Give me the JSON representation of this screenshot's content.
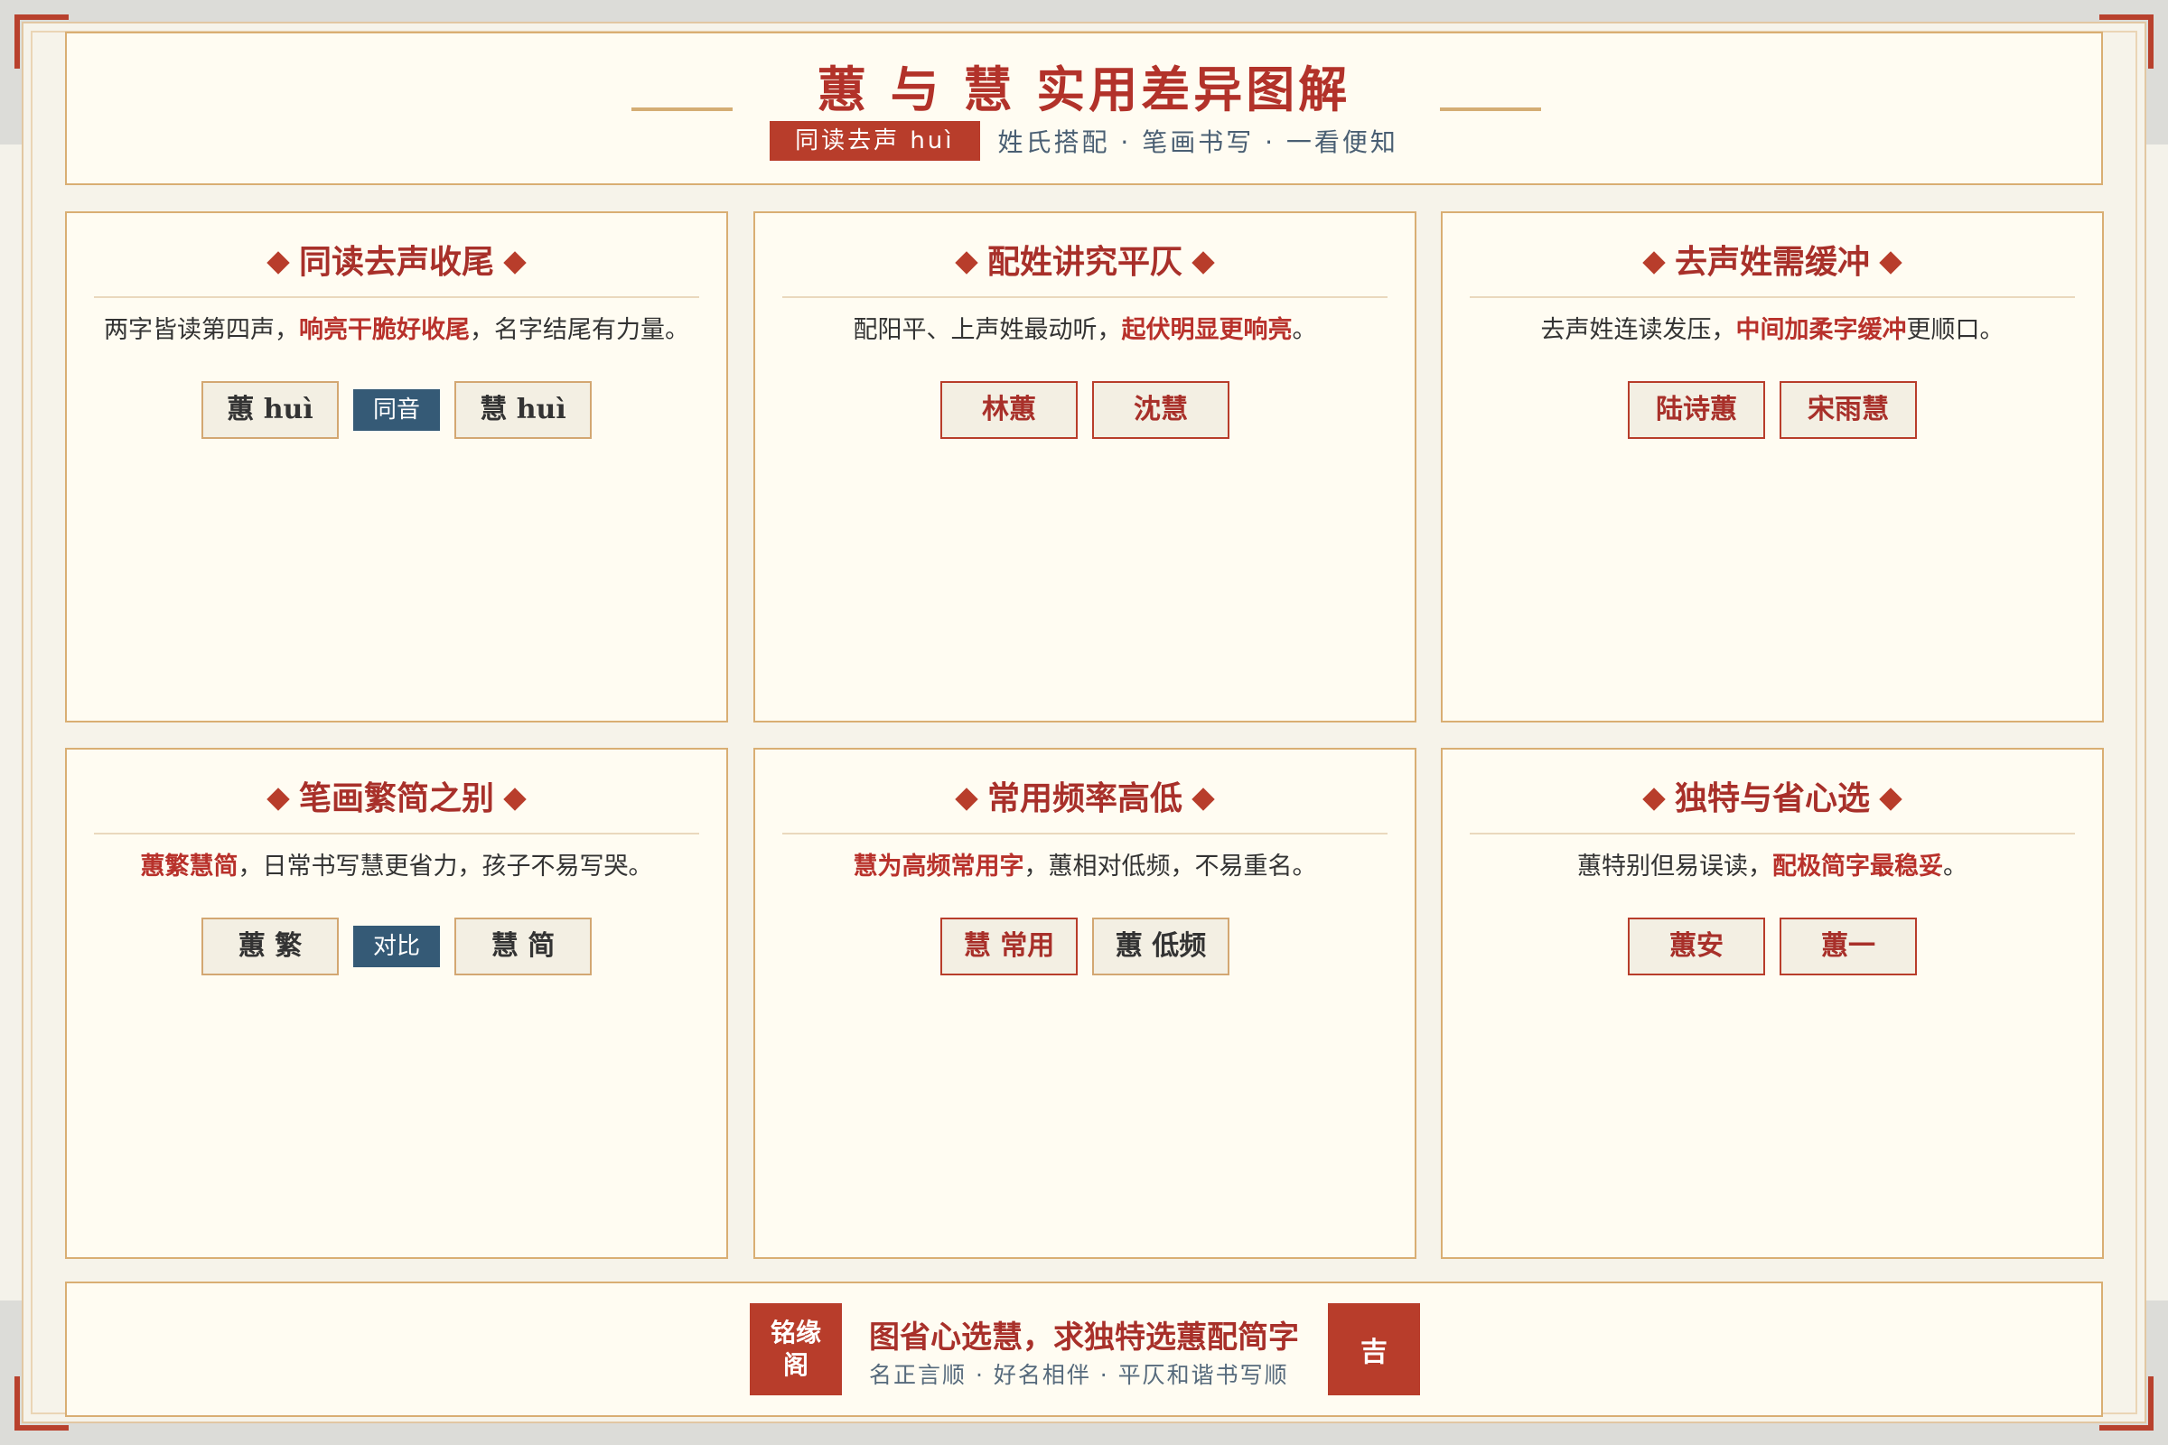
{
  "header": {
    "title": "蕙 与 慧 实用差异图解",
    "pill": "同读去声 huì",
    "subtitle": "姓氏搭配 · 笔画书写 · 一看便知"
  },
  "cards": [
    {
      "title": "同读去声收尾",
      "desc": [
        "两字皆读第四声，",
        "响亮干脆好收尾",
        "，名字结尾有力量。"
      ],
      "tags": [
        "蕙 huì",
        "慧 huì"
      ],
      "mid": "同音"
    },
    {
      "title": "配姓讲究平仄",
      "desc": [
        "配阳平、上声姓最动听，",
        "起伏明显更响亮",
        "。"
      ],
      "tags": [
        "林蕙",
        "沈慧"
      ]
    },
    {
      "title": "去声姓需缓冲",
      "desc": [
        "去声姓连读发压，",
        "中间加柔字缓冲",
        "更顺口。"
      ],
      "tags": [
        "陆诗蕙",
        "宋雨慧"
      ]
    },
    {
      "title": "笔画繁简之别",
      "desc": [
        "",
        "蕙繁慧简",
        "，日常书写慧更省力，孩子不易写哭。"
      ],
      "tags": [
        "蕙 繁",
        "慧 简"
      ],
      "mid": "对比"
    },
    {
      "title": "常用频率高低",
      "desc": [
        "",
        "慧为高频常用字",
        "，蕙相对低频，不易重名。"
      ],
      "tags": [
        "慧 常用",
        "蕙 低频"
      ]
    },
    {
      "title": "独特与省心选",
      "desc": [
        "蕙特别但易误读，",
        "配极简字最稳妥",
        "。"
      ],
      "tags": [
        "蕙安",
        "蕙一"
      ]
    }
  ],
  "footer": {
    "seal_left": "铭缘阁",
    "main": "图省心选慧，求独特选蕙配简字",
    "sub": "名正言顺 · 好名相伴 · 平仄和谐书写顺",
    "seal_right": "吉"
  },
  "colors": {
    "accent": "#b83d2b",
    "title_red": "#a8302a",
    "border_gold": "#d9ae73",
    "badge_blue": "#355a76",
    "paper": "#fffcf2"
  }
}
